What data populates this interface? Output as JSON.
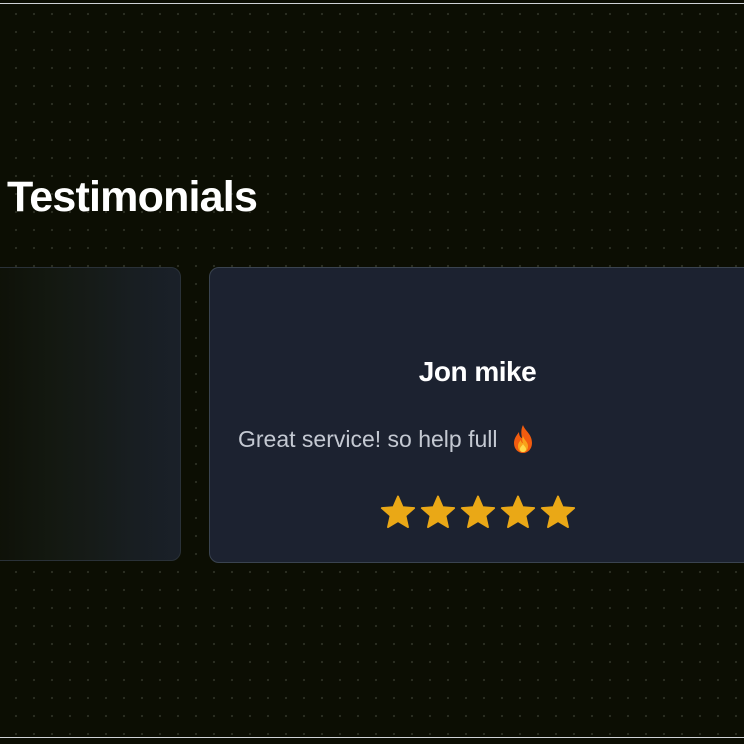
{
  "section": {
    "title": "Testimonials"
  },
  "testimonial": {
    "name": "Jon mike",
    "quote": "Great service! so help full",
    "emoji_icon": "fire-icon",
    "rating": 5,
    "rating_max": 5,
    "star_color": "#eaa816"
  },
  "colors": {
    "background": "#0c0e03",
    "card_background": "#1c2230",
    "title_text": "#ffffff",
    "quote_text": "#c4c9d2"
  }
}
